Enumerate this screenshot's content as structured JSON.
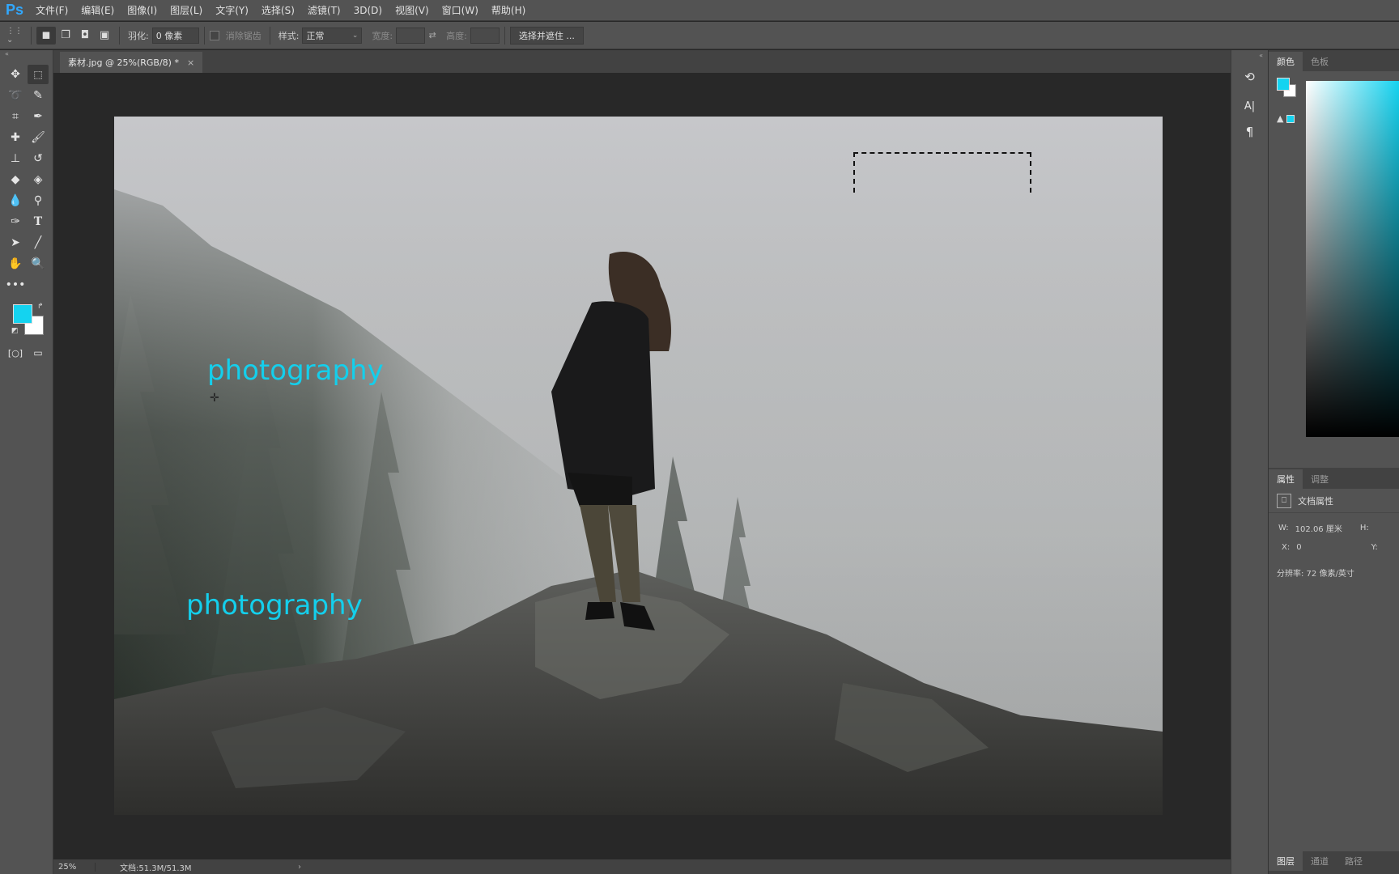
{
  "menubar": {
    "logo": "Ps",
    "items": [
      "文件(F)",
      "编辑(E)",
      "图像(I)",
      "图层(L)",
      "文字(Y)",
      "选择(S)",
      "滤镜(T)",
      "3D(D)",
      "视图(V)",
      "窗口(W)",
      "帮助(H)"
    ]
  },
  "options": {
    "feather_label": "羽化:",
    "feather_value": "0 像素",
    "antialias_label": "消除锯齿",
    "style_label": "样式:",
    "style_value": "正常",
    "width_label": "宽度:",
    "height_label": "高度:",
    "select_mask_button": "选择并遮住 ..."
  },
  "document": {
    "tab_title": "素材.jpg @ 25%(RGB/8) *",
    "close_symbol": "×",
    "text_layer_1": "photography",
    "text_layer_2": "photography"
  },
  "status": {
    "zoom": "25%",
    "doc_size": "文档:51.3M/51.3M",
    "arrow": "›"
  },
  "panels": {
    "color_tabs": [
      "颜色",
      "色板"
    ],
    "props_tabs": [
      "属性",
      "调整"
    ],
    "props_title": "文档属性",
    "w_label": "W:",
    "w_value": "102.06 厘米",
    "h_label": "H:",
    "x_label": "X:",
    "x_value": "0",
    "y_label": "Y:",
    "resolution": "分辨率: 72 像素/英寸",
    "bottom_tabs": [
      "图层",
      "通道",
      "路径"
    ]
  },
  "colors": {
    "foreground": "#14d3f0",
    "background": "#ffffff",
    "accent_text": "#14cfec"
  }
}
